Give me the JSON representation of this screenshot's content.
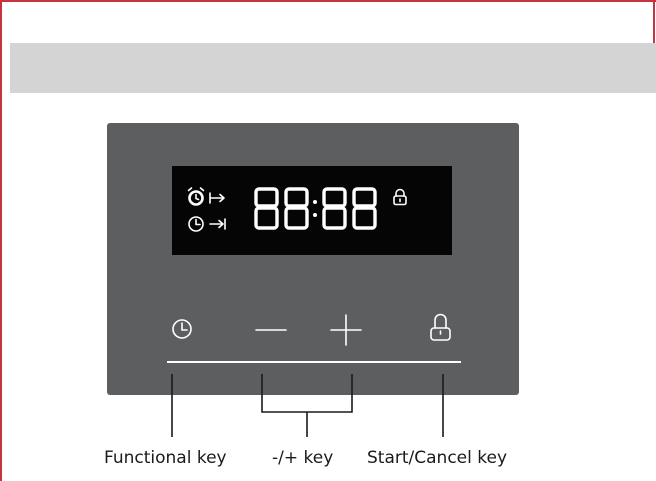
{
  "display": {
    "time_digits": "88:88"
  },
  "icons": {
    "alarm": "alarm-clock-icon",
    "duration": "duration-arrow-icon",
    "clock": "clock-icon",
    "end_time": "end-time-arrow-icon",
    "lock": "lock-icon",
    "minus": "minus-icon",
    "plus": "plus-icon"
  },
  "labels": {
    "functional_key": "Functional key",
    "minus_plus_key": "-/+ key",
    "start_cancel_key": "Start/Cancel key"
  },
  "colors": {
    "panel": "#5d5e60",
    "display": "#050505",
    "band": "#d4d4d4",
    "frame": "#c9323f"
  }
}
